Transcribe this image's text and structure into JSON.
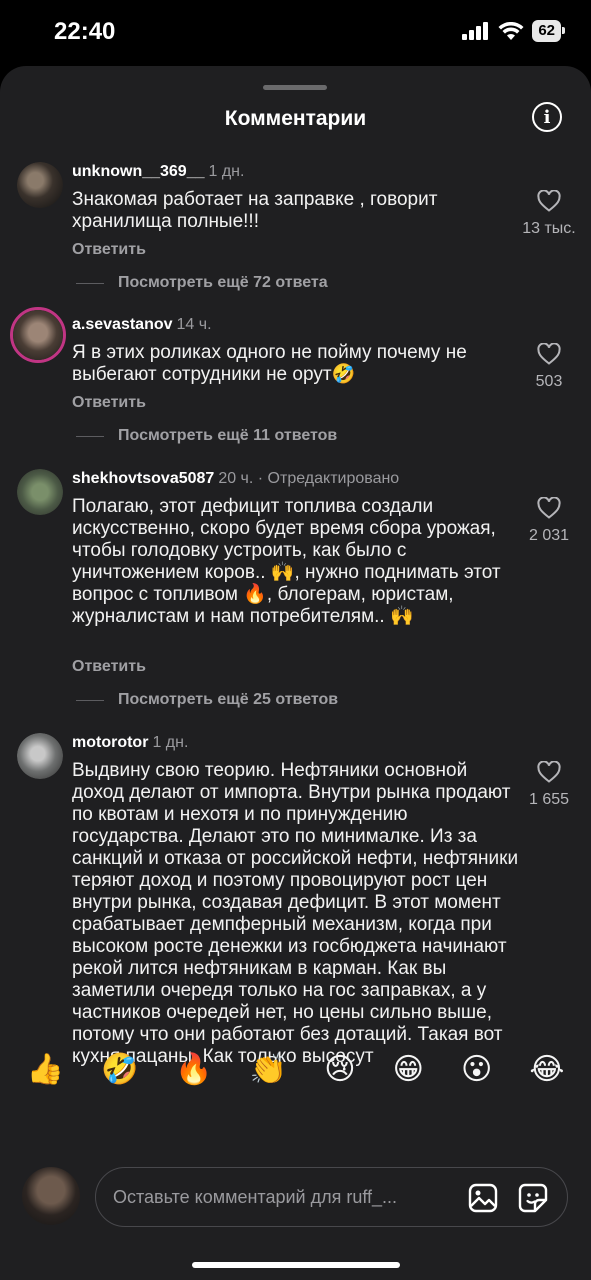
{
  "status_bar": {
    "time": "22:40",
    "battery": "62"
  },
  "header": {
    "title": "Комментарии"
  },
  "comments": [
    {
      "user": "unknown__369__",
      "when": "1 дн.",
      "text": "Знакомая работает на заправке , говорит хранилища полные!!!",
      "reply": "Ответить",
      "likes": "13 тыс.",
      "more_replies": "Посмотреть ещё 72 ответа"
    },
    {
      "user": "a.sevastanov",
      "when": "14 ч.",
      "text": "Я в этих роликах одного не пойму почему не выбегают сотрудники не орут🤣",
      "reply": "Ответить",
      "likes": "503",
      "more_replies": "Посмотреть ещё 11 ответов"
    },
    {
      "user": "shekhovtsova5087",
      "when": "20 ч. · Отредактировано",
      "text": "Полагаю, этот дефицит топлива создали искусственно, скоро будет время сбора урожая, чтобы голодовку устроить, как  было с уничтожением коров.. 🙌, нужно поднимать этот вопрос с топливом 🔥, блогерам, юристам, журналистам и нам потребителям.. 🙌",
      "reply": "Ответить",
      "likes": "2 031",
      "more_replies": "Посмотреть ещё 25 ответов"
    },
    {
      "user": "motorotor",
      "when": "1 дн.",
      "text": "Выдвину свою теорию. Нефтяники основной доход делают от импорта. Внутри рынка продают по квотам и нехотя и по принуждению государства. Делают это по минималке. Из за санкций и отказа от российской нефти, нефтяники теряют доход и поэтому провоцируют рост цен внутри рынка, создавая дефицит. В этот момент срабатывает демпферный механизм, когда при высоком росте денежки из госбюджета начинают рекой лится нефтяникам в карман. Как вы заметили очередя только на гос заправках, а у частников очередей нет, но цены сильно выше, потому что они работают без дотаций. Такая вот кухня пацаны. Как только высосут",
      "likes": "1 655"
    }
  ],
  "emoji_bar": [
    "👍",
    "🤣",
    "🔥",
    "👏",
    "😢",
    "😁",
    "😮",
    "😂"
  ],
  "composer": {
    "placeholder": "Оставьте комментарий для ruff_..."
  }
}
